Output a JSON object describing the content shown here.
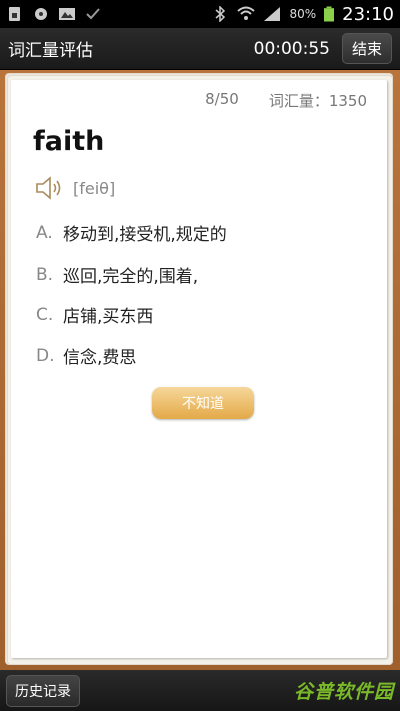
{
  "status_bar": {
    "battery": "80%",
    "time": "23:10",
    "icons": [
      "sim-icon",
      "media-icon",
      "image-icon",
      "check-icon",
      "bluetooth-icon",
      "wifi-icon",
      "signal-icon",
      "battery-icon"
    ]
  },
  "header": {
    "title": "词汇量评估",
    "timer": "00:00:55",
    "end_label": "结束"
  },
  "card": {
    "progress": "8/50",
    "vocab_count": "词汇量：1350",
    "word": "faith",
    "phonetic": "[feiθ]",
    "options": [
      {
        "letter": "A.",
        "text": "移动到,接受机,规定的"
      },
      {
        "letter": "B.",
        "text": "巡回,完全的,围着,"
      },
      {
        "letter": "C.",
        "text": "店铺,买东西"
      },
      {
        "letter": "D.",
        "text": "信念,费思"
      }
    ],
    "unknown_label": "不知道"
  },
  "footer": {
    "history_label": "历史记录",
    "watermark": "谷普软件园"
  },
  "colors": {
    "frame": "#a8662f",
    "button_gold": "#e3a947",
    "watermark": "#7ab928"
  }
}
